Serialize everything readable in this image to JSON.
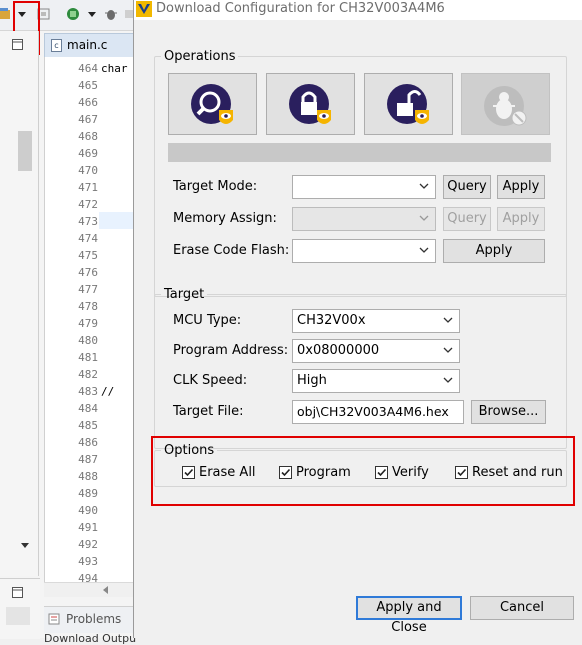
{
  "ide": {
    "editor_tab": "main.c",
    "line_numbers": [
      "464",
      "465",
      "466",
      "467",
      "468",
      "469",
      "470",
      "471",
      "472",
      "473",
      "474",
      "475",
      "476",
      "477",
      "478",
      "479",
      "480",
      "481",
      "482",
      "483",
      "484",
      "485",
      "486",
      "487",
      "488",
      "489",
      "490",
      "491",
      "492",
      "493",
      "494"
    ],
    "code_lines": {
      "464": "char",
      "483": "//"
    },
    "bottom_tab": "Problems",
    "bottom_text": "Download Output Messages"
  },
  "dialog": {
    "title": "Download Configuration for CH32V003A4M6",
    "operations": {
      "legend": "Operations",
      "buttons": [
        {
          "icon": "query-magnifier-icon"
        },
        {
          "icon": "lock-icon"
        },
        {
          "icon": "unlock-icon"
        },
        {
          "icon": "debug-bug-icon",
          "disabled": true
        }
      ],
      "target_mode_label": "Target Mode:",
      "target_mode_value": "",
      "memory_assign_label": "Memory Assign:",
      "memory_assign_value": "",
      "erase_flash_label": "Erase Code Flash:",
      "erase_flash_value": "",
      "query_label": "Query",
      "apply_label": "Apply"
    },
    "target": {
      "legend": "Target",
      "mcu_type_label": "MCU Type:",
      "mcu_type_value": "CH32V00x",
      "program_address_label": "Program Address:",
      "program_address_value": "0x08000000",
      "clk_speed_label": "CLK Speed:",
      "clk_speed_value": "High",
      "target_file_label": "Target File:",
      "target_file_value": "obj\\CH32V003A4M6.hex",
      "browse_label": "Browse..."
    },
    "options": {
      "legend": "Options",
      "items": [
        {
          "label": "Erase All",
          "checked": true
        },
        {
          "label": "Program",
          "checked": true
        },
        {
          "label": "Verify",
          "checked": true
        },
        {
          "label": "Reset and run",
          "checked": true
        }
      ]
    },
    "apply_close_label": "Apply and Close",
    "cancel_label": "Cancel",
    "accent_color": "#2f7ad8",
    "highlight_color": "#e00000"
  }
}
